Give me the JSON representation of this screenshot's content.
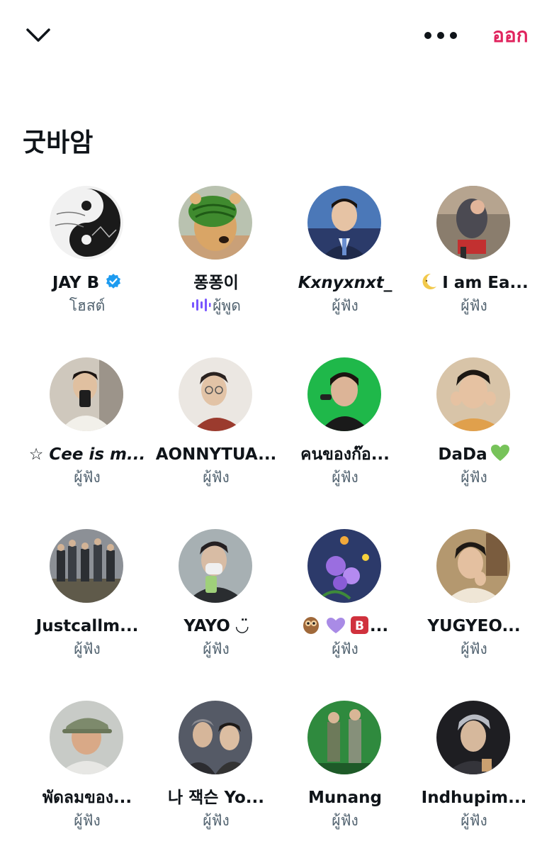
{
  "header": {
    "leave_label": "ออก"
  },
  "space": {
    "title": "굿바암"
  },
  "participants": [
    {
      "name": "JAY B",
      "role": "โฮสต์",
      "verified": true,
      "avatar_color": "#c9c9c9"
    },
    {
      "name": "퐁퐁이",
      "role": "ผู้พูด",
      "speaking": true,
      "avatar_color": "#d8b58a"
    },
    {
      "name": "Kxnyxnxt_",
      "role": "ผู้ฟัง",
      "avatar_color": "#4b78b8"
    },
    {
      "name": "I am Ea...",
      "role": "ผู้ฟัง",
      "emoji": "crescent-moon",
      "avatar_color": "#8a7d6d"
    },
    {
      "name": "☆ Cee is m...",
      "role": "ผู้ฟัง",
      "avatar_color": "#b8aea3"
    },
    {
      "name": "AONNYTUA...",
      "role": "ผู้ฟัง",
      "avatar_color": "#9b3b2e"
    },
    {
      "name": "คนของก๊อ...",
      "role": "ผู้ฟัง",
      "avatar_color": "#1fb84a"
    },
    {
      "name": "DaDa",
      "role": "ผู้ฟัง",
      "emoji": "green-heart",
      "avatar_color": "#c99b6a"
    },
    {
      "name": "Justcallm...",
      "role": "ผู้ฟัง",
      "avatar_color": "#6b6f72"
    },
    {
      "name": "YAYO ◡̈",
      "role": "ผู้ฟัง",
      "avatar_color": "#7a8a8a"
    },
    {
      "name": "...",
      "role": "ผู้ฟัง",
      "emoji": "owl-purple-heart-b",
      "avatar_color": "#2c3a6a"
    },
    {
      "name": "YUGYEO...",
      "role": "ผู้ฟัง",
      "avatar_color": "#a58a6c"
    },
    {
      "name": "พัดลมของ...",
      "role": "ผู้ฟัง",
      "avatar_color": "#9aa39a"
    },
    {
      "name": "나 잭슨 Yo...",
      "role": "ผู้ฟัง",
      "avatar_color": "#555a66"
    },
    {
      "name": "Munang",
      "role": "ผู้ฟัง",
      "avatar_color": "#2f8a3e"
    },
    {
      "name": "Indhupim...",
      "role": "ผู้ฟัง",
      "avatar_color": "#1e1e22"
    }
  ],
  "colors": {
    "leave": "#e0245e",
    "verified": "#1d9bf0",
    "speaker_wave": "#7856ff",
    "secondary_text": "#536471"
  },
  "icons": [
    "chevron-down-icon",
    "more-icon",
    "verified-badge-icon",
    "speaking-wave-icon"
  ]
}
